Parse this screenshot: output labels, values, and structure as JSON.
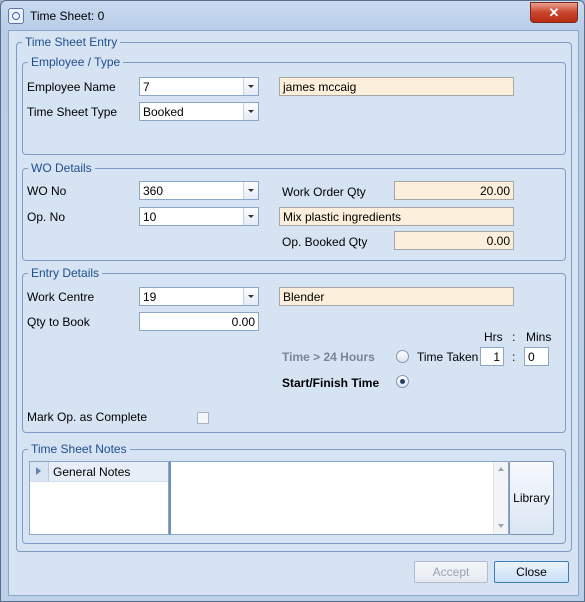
{
  "window": {
    "title": "Time Sheet: 0",
    "close_glyph": "✕"
  },
  "time_sheet_entry": {
    "legend": "Time Sheet Entry",
    "employee_type": {
      "legend": "Employee / Type",
      "employee_name_label": "Employee Name",
      "employee_name_value": "7",
      "employee_fullname": "james mccaig",
      "time_sheet_type_label": "Time Sheet Type",
      "time_sheet_type_value": "Booked"
    },
    "wo_details": {
      "legend": "WO Details",
      "wo_no_label": "WO No",
      "wo_no_value": "360",
      "work_order_qty_label": "Work Order Qty",
      "work_order_qty_value": "20.00",
      "op_no_label": "Op. No",
      "op_no_value": "10",
      "op_description": "Mix plastic ingredients",
      "op_booked_qty_label": "Op. Booked Qty",
      "op_booked_qty_value": "0.00"
    },
    "entry_details": {
      "legend": "Entry Details",
      "work_centre_label": "Work Centre",
      "work_centre_value": "19",
      "work_centre_name": "Blender",
      "qty_to_book_label": "Qty to Book",
      "qty_to_book_value": "0.00",
      "hrs_label": "Hrs",
      "colon": ":",
      "mins_label": "Mins",
      "time_over_24_label": "Time > 24 Hours",
      "time_taken_label": "Time Taken",
      "hrs_value": "1",
      "mins_value": "0",
      "start_finish_label": "Start/Finish Time",
      "start_finish_selected": true,
      "mark_complete_label": "Mark Op. as Complete",
      "mark_complete_checked": false
    },
    "notes": {
      "legend": "Time Sheet Notes",
      "rows": [
        {
          "label": "General Notes"
        }
      ],
      "library_label": "Library"
    }
  },
  "footer": {
    "accept_label": "Accept",
    "close_label": "Close"
  }
}
